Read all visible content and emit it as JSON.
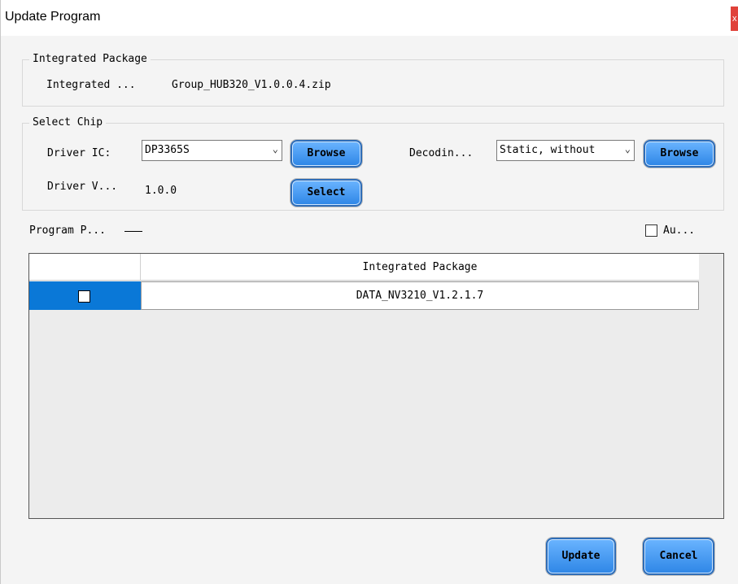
{
  "window": {
    "title": "Update Program",
    "close_label": "x"
  },
  "integrated_package": {
    "legend": "Integrated Package",
    "label": "Integrated ...",
    "value": "Group_HUB320_V1.0.0.4.zip"
  },
  "select_chip": {
    "legend": "Select Chip",
    "driver_ic_label": "Driver IC:",
    "driver_ic_value": "DP3365S",
    "browse_label_1": "Browse",
    "decoding_label": "Decodin...",
    "decoding_value": "Static, without",
    "browse_label_2": "Browse",
    "driver_version_label": "Driver V...",
    "driver_version_value": "1.0.0",
    "select_label": "Select"
  },
  "program": {
    "label": "Program P...",
    "auto_label": "Au..."
  },
  "table": {
    "column_header": "Integrated Package",
    "rows": [
      {
        "checked": false,
        "package": "DATA_NV3210_V1.2.1.7"
      }
    ]
  },
  "footer": {
    "update_label": "Update",
    "cancel_label": "Cancel"
  },
  "colors": {
    "selection": "#0a78d7",
    "button_blue": "#2e86e6",
    "close_red": "#e0423a"
  }
}
